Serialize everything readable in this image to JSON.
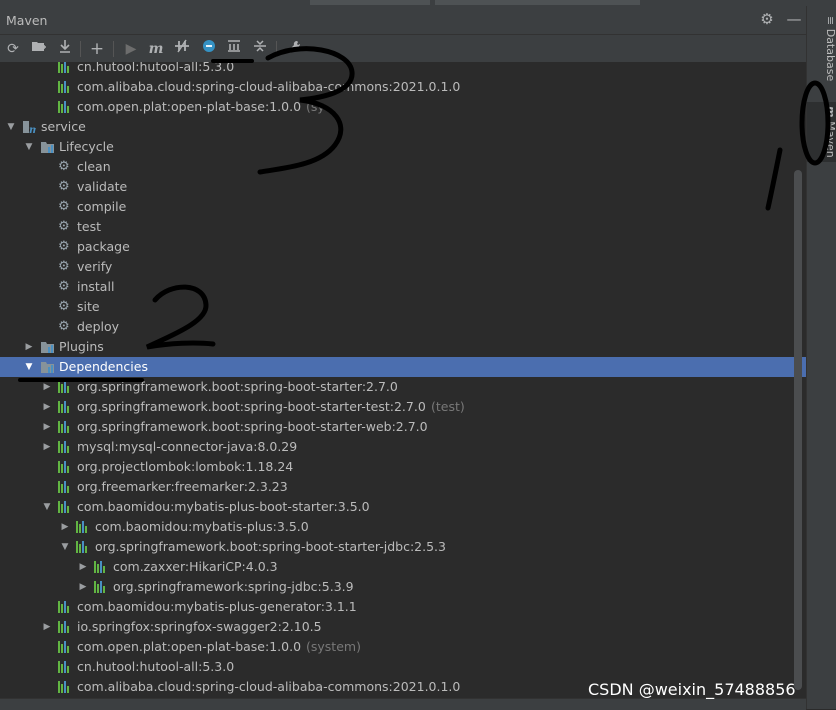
{
  "panel": {
    "title": "Maven"
  },
  "right_tabs": {
    "database": "Database",
    "maven": "Maven"
  },
  "toolbar_icons": [
    "reload-icon",
    "add-folder-icon",
    "download-icon",
    "plus-icon",
    "run-icon",
    "execute-goal-icon",
    "toggle-offline-icon",
    "skip-tests-icon",
    "show-dependencies-icon",
    "collapse-all-icon",
    "settings-wrench-icon"
  ],
  "tree": {
    "rows": [
      {
        "label": "cn.hutool:hutool-all:5.3.0",
        "suffix": "",
        "indent": 58,
        "arrow": "",
        "icon": "dep"
      },
      {
        "label": "com.alibaba.cloud:spring-cloud-alibaba-commons:2021.0.1.0",
        "suffix": "",
        "indent": 58,
        "arrow": "",
        "icon": "dep"
      },
      {
        "label": "com.open.plat:open-plat-base:1.0.0",
        "suffix": "(sy",
        "indent": 58,
        "arrow": "",
        "icon": "dep"
      },
      {
        "label": "service",
        "suffix": "",
        "indent": 22,
        "arrow": "down",
        "icon": "module"
      },
      {
        "label": "Lifecycle",
        "suffix": "",
        "indent": 40,
        "arrow": "down",
        "icon": "folder"
      },
      {
        "label": "clean",
        "suffix": "",
        "indent": 58,
        "arrow": "",
        "icon": "gear"
      },
      {
        "label": "validate",
        "suffix": "",
        "indent": 58,
        "arrow": "",
        "icon": "gear"
      },
      {
        "label": "compile",
        "suffix": "",
        "indent": 58,
        "arrow": "",
        "icon": "gear"
      },
      {
        "label": "test",
        "suffix": "",
        "indent": 58,
        "arrow": "",
        "icon": "gear"
      },
      {
        "label": "package",
        "suffix": "",
        "indent": 58,
        "arrow": "",
        "icon": "gear"
      },
      {
        "label": "verify",
        "suffix": "",
        "indent": 58,
        "arrow": "",
        "icon": "gear"
      },
      {
        "label": "install",
        "suffix": "",
        "indent": 58,
        "arrow": "",
        "icon": "gear"
      },
      {
        "label": "site",
        "suffix": "",
        "indent": 58,
        "arrow": "",
        "icon": "gear"
      },
      {
        "label": "deploy",
        "suffix": "",
        "indent": 58,
        "arrow": "",
        "icon": "gear"
      },
      {
        "label": "Plugins",
        "suffix": "",
        "indent": 40,
        "arrow": "right",
        "icon": "folder"
      },
      {
        "label": "Dependencies",
        "suffix": "",
        "indent": 40,
        "arrow": "down",
        "icon": "folder",
        "selected": true
      },
      {
        "label": "org.springframework.boot:spring-boot-starter:2.7.0",
        "suffix": "",
        "indent": 58,
        "arrow": "right",
        "icon": "dep"
      },
      {
        "label": "org.springframework.boot:spring-boot-starter-test:2.7.0",
        "suffix": "(test)",
        "indent": 58,
        "arrow": "right",
        "icon": "dep"
      },
      {
        "label": "org.springframework.boot:spring-boot-starter-web:2.7.0",
        "suffix": "",
        "indent": 58,
        "arrow": "right",
        "icon": "dep"
      },
      {
        "label": "mysql:mysql-connector-java:8.0.29",
        "suffix": "",
        "indent": 58,
        "arrow": "right",
        "icon": "dep"
      },
      {
        "label": "org.projectlombok:lombok:1.18.24",
        "suffix": "",
        "indent": 58,
        "arrow": "",
        "icon": "dep"
      },
      {
        "label": "org.freemarker:freemarker:2.3.23",
        "suffix": "",
        "indent": 58,
        "arrow": "",
        "icon": "dep"
      },
      {
        "label": "com.baomidou:mybatis-plus-boot-starter:3.5.0",
        "suffix": "",
        "indent": 58,
        "arrow": "down",
        "icon": "dep"
      },
      {
        "label": "com.baomidou:mybatis-plus:3.5.0",
        "suffix": "",
        "indent": 76,
        "arrow": "right",
        "icon": "dep"
      },
      {
        "label": "org.springframework.boot:spring-boot-starter-jdbc:2.5.3",
        "suffix": "",
        "indent": 76,
        "arrow": "down",
        "icon": "dep"
      },
      {
        "label": "com.zaxxer:HikariCP:4.0.3",
        "suffix": "",
        "indent": 94,
        "arrow": "right",
        "icon": "dep"
      },
      {
        "label": "org.springframework:spring-jdbc:5.3.9",
        "suffix": "",
        "indent": 94,
        "arrow": "right",
        "icon": "dep"
      },
      {
        "label": "com.baomidou:mybatis-plus-generator:3.1.1",
        "suffix": "",
        "indent": 58,
        "arrow": "",
        "icon": "dep"
      },
      {
        "label": "io.springfox:springfox-swagger2:2.10.5",
        "suffix": "",
        "indent": 58,
        "arrow": "right",
        "icon": "dep"
      },
      {
        "label": "com.open.plat:open-plat-base:1.0.0",
        "suffix": "(system)",
        "indent": 58,
        "arrow": "",
        "icon": "dep"
      },
      {
        "label": "cn.hutool:hutool-all:5.3.0",
        "suffix": "",
        "indent": 58,
        "arrow": "",
        "icon": "dep"
      },
      {
        "label": "com.alibaba.cloud:spring-cloud-alibaba-commons:2021.0.1.0",
        "suffix": "",
        "indent": 58,
        "arrow": "",
        "icon": "dep"
      }
    ]
  },
  "watermark": "CSDN @weixin_57488856",
  "colors": {
    "selection": "#4b6eaf",
    "dependency_icon": "#62b543",
    "panel_bg": "#2b2b2b"
  },
  "annotations": [
    "1",
    "0",
    "2",
    "3"
  ]
}
